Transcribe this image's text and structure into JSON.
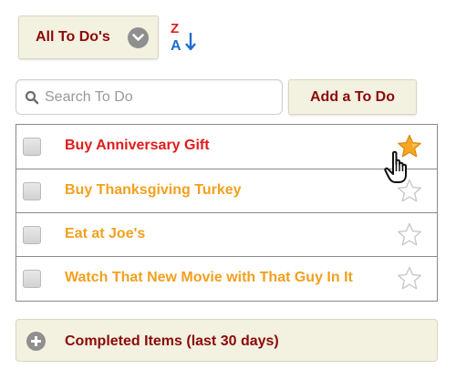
{
  "header": {
    "filter_label": "All To Do's",
    "filter_icon": "chevron-down-icon",
    "sort_icon": "sort-z-a-icon",
    "sort_letters": {
      "top": "Z",
      "bottom": "A"
    }
  },
  "search": {
    "placeholder": "Search To Do",
    "value": ""
  },
  "add_button": {
    "label": "Add a To Do"
  },
  "todos": [
    {
      "text": "Buy Anniversary Gift",
      "checked": false,
      "starred": true,
      "color": "#e11b1b"
    },
    {
      "text": "Buy Thanksgiving Turkey",
      "checked": false,
      "starred": false,
      "color": "#f2a01e"
    },
    {
      "text": "Eat at Joe's",
      "checked": false,
      "starred": false,
      "color": "#f2a01e"
    },
    {
      "text": "Watch That New Movie with That Guy In It",
      "checked": false,
      "starred": false,
      "color": "#f2a01e"
    }
  ],
  "completed": {
    "label": "Completed Items (last 30 days)",
    "icon": "plus-icon"
  },
  "colors": {
    "accent": "#8b0a0a",
    "panel_bg": "#f3f1e0",
    "star_active": "#f5a623",
    "sort_red": "#e31b1b",
    "sort_blue": "#1e6fd0"
  }
}
